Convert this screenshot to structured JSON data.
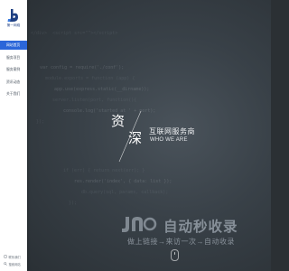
{
  "brand": {
    "name": "第一网络"
  },
  "nav": {
    "items": [
      {
        "label": "网站首页",
        "active": true
      },
      {
        "label": "服务项目",
        "active": false
      },
      {
        "label": "服务案例",
        "active": false
      },
      {
        "label": "资讯动态",
        "active": false
      },
      {
        "label": "关于我们",
        "active": false
      }
    ]
  },
  "sidebar_bottom": {
    "contact_label": "联系我们",
    "search_label": "搜索网站"
  },
  "hero": {
    "char1": "资",
    "char2": "深",
    "title": "互联网服务商",
    "subtitle": "WHO WE ARE"
  },
  "watermark": {
    "title": "自动秒收录",
    "subtitle": "做上链接→来访一次→自动收录"
  },
  "colors": {
    "accent": "#2b66d9",
    "brand": "#1e3f82",
    "hero_bg": "#394148"
  }
}
